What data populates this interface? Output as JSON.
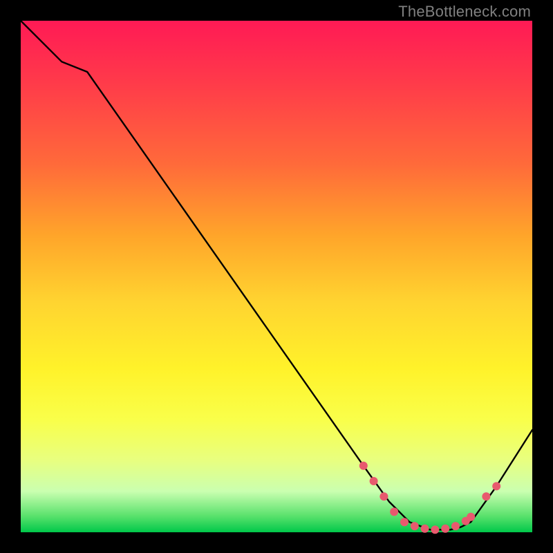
{
  "watermark": "TheBottleneck.com",
  "chart_data": {
    "type": "line",
    "title": "",
    "xlabel": "",
    "ylabel": "",
    "xlim": [
      0,
      100
    ],
    "ylim": [
      0,
      100
    ],
    "series": [
      {
        "name": "curve",
        "x": [
          0,
          8,
          13,
          67,
          72,
          76,
          80,
          84,
          86,
          88,
          93,
          100
        ],
        "y": [
          100,
          92,
          90,
          13,
          6,
          2,
          0.5,
          0.5,
          1,
          2,
          9,
          20
        ]
      }
    ],
    "markers": {
      "name": "dots",
      "color": "#e85a6e",
      "x": [
        67,
        69,
        71,
        73,
        75,
        77,
        79,
        81,
        83,
        85,
        87,
        88,
        91,
        93
      ],
      "y": [
        13,
        10,
        7,
        4,
        2,
        1.2,
        0.7,
        0.5,
        0.7,
        1.2,
        2.2,
        3,
        7,
        9
      ]
    }
  },
  "colors": {
    "curve_stroke": "#000000",
    "marker_fill": "#e85a6e"
  }
}
